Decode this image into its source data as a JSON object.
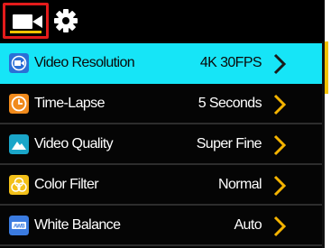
{
  "top_bar": {
    "tabs": [
      {
        "icon": "video-camera-icon",
        "selected": true
      },
      {
        "icon": "gear-icon",
        "selected": false
      }
    ]
  },
  "menu": {
    "items": [
      {
        "label": "Video Resolution",
        "value": "4K 30FPS",
        "icon": "video-resolution-icon",
        "selected": true
      },
      {
        "label": "Time-Lapse",
        "value": "5 Seconds",
        "icon": "clock-icon",
        "selected": false
      },
      {
        "label": "Video Quality",
        "value": "Super Fine",
        "icon": "mountain-icon",
        "selected": false
      },
      {
        "label": "Color Filter",
        "value": "Normal",
        "icon": "color-filter-icon",
        "selected": false
      },
      {
        "label": "White Balance",
        "value": "Auto",
        "icon": "awb-icon",
        "selected": false
      }
    ]
  },
  "colors": {
    "selected_row": "#16e5f7",
    "accent_chevron": "#f5b400",
    "active_tab_border": "#e31b1b",
    "active_tab_underline": "#f2c200",
    "scroll_thumb": "#f2c200"
  },
  "icon_text": {
    "awb": "AWB"
  }
}
